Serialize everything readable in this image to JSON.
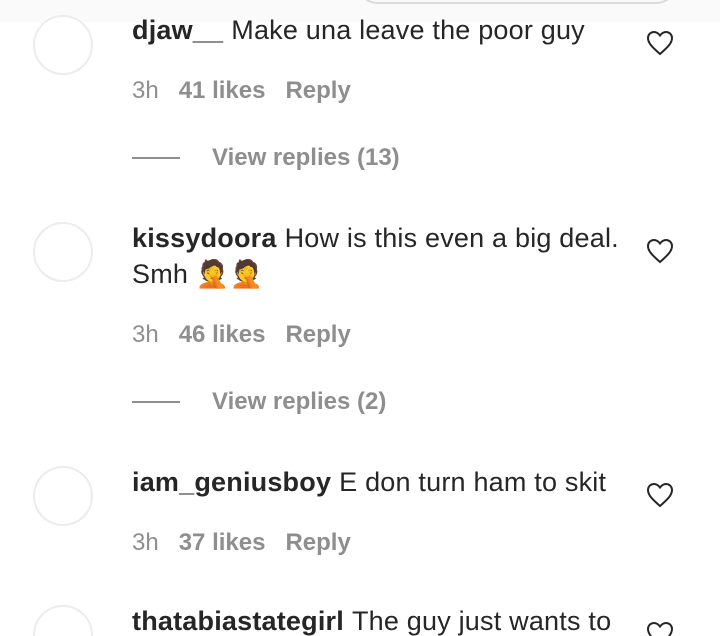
{
  "comments": [
    {
      "username": "djaw__",
      "text": "Make una leave the poor guy",
      "time": "3h",
      "likes": "41 likes",
      "reply": "Reply",
      "view_replies": "View replies (13)"
    },
    {
      "username": "kissydoora",
      "text": "How is this even a big deal. Smh 🤦🤦",
      "time": "3h",
      "likes": "46 likes",
      "reply": "Reply",
      "view_replies": "View replies (2)"
    },
    {
      "username": "iam_geniusboy",
      "text": "E don turn ham to skit",
      "time": "3h",
      "likes": "37 likes",
      "reply": "Reply"
    },
    {
      "username": "thatabiastategirl",
      "text": "The guy just wants to"
    }
  ],
  "icons": {
    "like": "heart-outline-icon",
    "avatar": "avatar"
  },
  "colors": {
    "text": "#262626",
    "secondary": "#8e8e8e",
    "avatar_border": "#ececec"
  }
}
